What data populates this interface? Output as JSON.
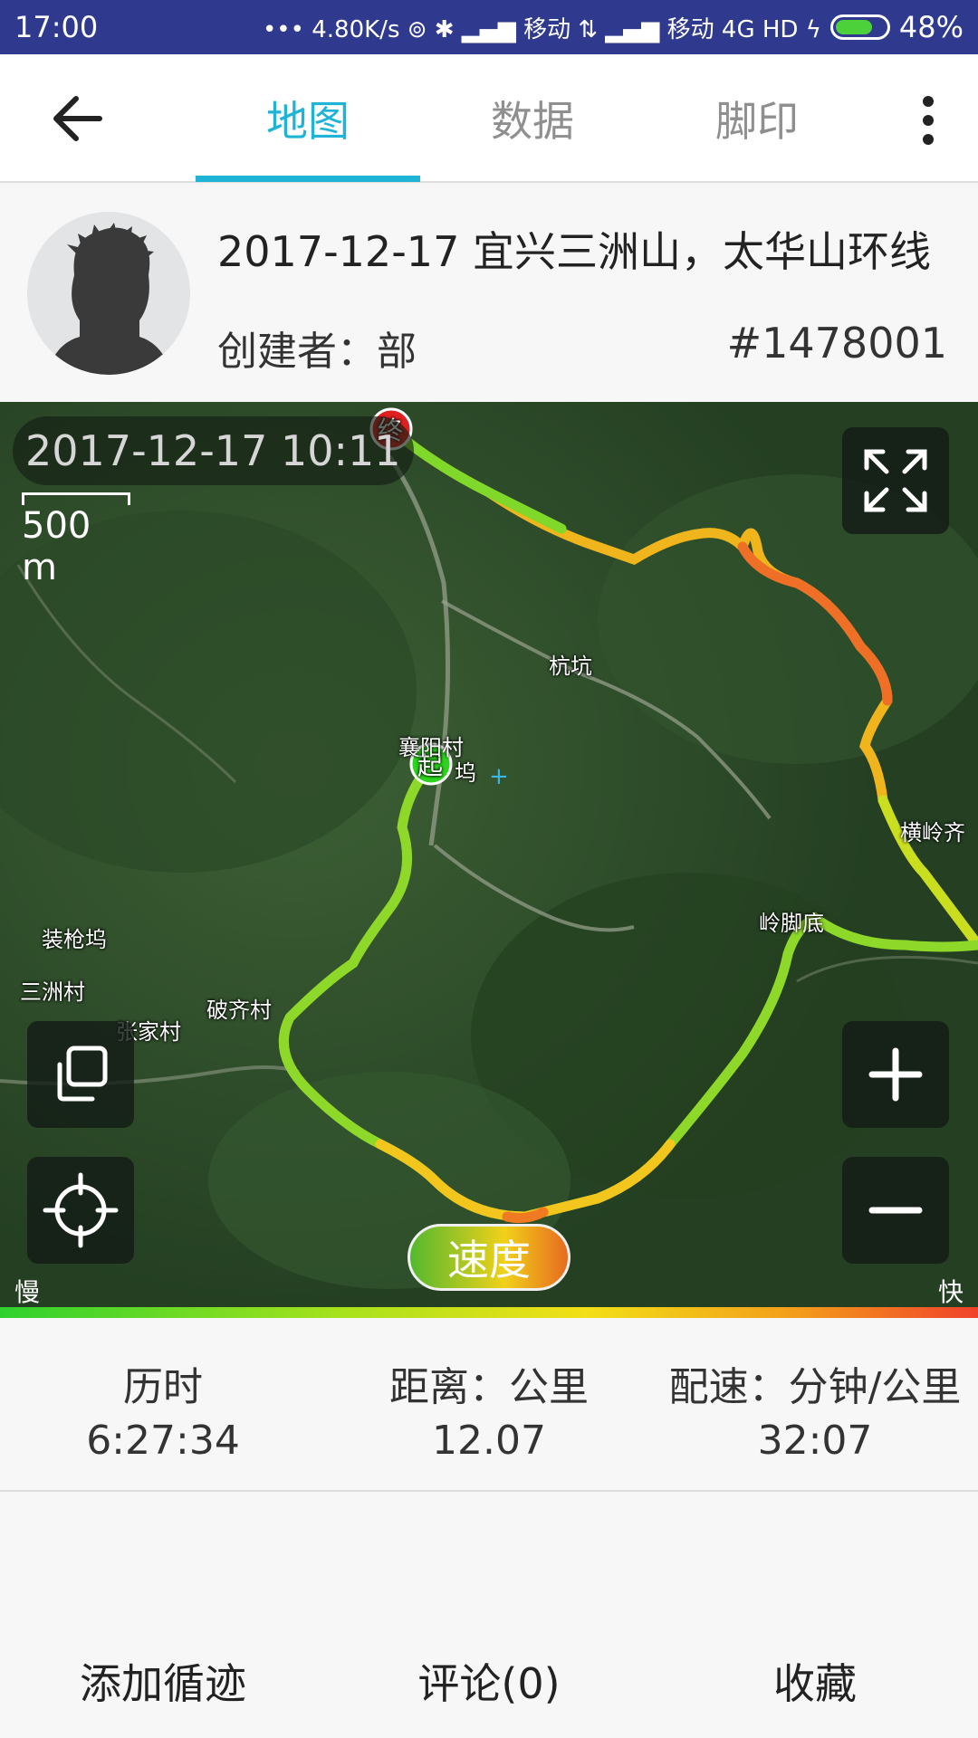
{
  "status_bar": {
    "time": "17:00",
    "right_text": "••• 4.80K/s ⊚ ✱ ▂▄▆ 移动 ⇅ ▂▄▆ 移动 4G HD ϟ",
    "battery": "48%",
    "battery_level": 0.48
  },
  "appbar": {
    "tabs": [
      {
        "label": "地图"
      },
      {
        "label": "数据"
      },
      {
        "label": "脚印"
      }
    ],
    "back_icon": "arrow-left-icon",
    "more_icon": "more-vertical-icon"
  },
  "track": {
    "title": "2017-12-17 宜兴三洲山，太华山环线",
    "creator": "创建者：部",
    "id": "#1478001"
  },
  "map": {
    "timestamp": "2017-12-17 10:11",
    "scale_label": "500 m",
    "start_marker": "起",
    "end_marker": "终",
    "places": [
      "杭坑",
      "襄阳村",
      "坞",
      "横岭齐",
      "岭脚底",
      "装枪坞",
      "三洲村",
      "破齐村",
      "张家村"
    ],
    "speed_button": "速度",
    "slow_label": "慢",
    "fast_label": "快",
    "colors": {
      "slow": "#2fd12e",
      "mid": "#f2df17",
      "fast": "#f0412b"
    }
  },
  "stats": [
    {
      "label": "历时",
      "value": "6:27:34"
    },
    {
      "label": "距离：公里",
      "value": "12.07"
    },
    {
      "label": "配速：分钟/公里",
      "value": "32:07"
    }
  ],
  "actions": {
    "add_track": "添加循迹",
    "comments": "评论(0)",
    "favorite": "收藏"
  }
}
